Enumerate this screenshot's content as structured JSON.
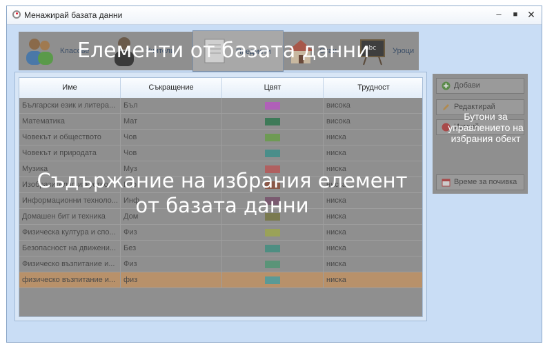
{
  "window": {
    "title": "Менажирай базата данни"
  },
  "tabs": [
    {
      "label": "Класове",
      "icon": "users-icon"
    },
    {
      "label": "Учители",
      "icon": "teacher-icon"
    },
    {
      "label": "Предмети",
      "icon": "notebook-icon"
    },
    {
      "label": "Стаи",
      "icon": "house-icon"
    },
    {
      "label": "Уроци",
      "icon": "chalkboard-icon"
    }
  ],
  "overlays": {
    "tabs": "Елементи от базата данни",
    "content_line1": "Съдържание на избрания елемент",
    "content_line2": "от базата данни",
    "buttons": "Бутони за управлението на избрания обект"
  },
  "grid": {
    "columns": [
      "Име",
      "Съкращение",
      "Цвят",
      "Трудност"
    ],
    "rows": [
      {
        "name": "Български език и литера...",
        "abbr": "Бъл",
        "color": "#b060b8",
        "difficulty": "висока"
      },
      {
        "name": "Математика",
        "abbr": "Мат",
        "color": "#3e7a58",
        "difficulty": "висока"
      },
      {
        "name": "Човекът и обществото",
        "abbr": "Чов",
        "color": "#6e9a54",
        "difficulty": "ниска"
      },
      {
        "name": "Човекът и природата",
        "abbr": "Чов",
        "color": "#4a8e8a",
        "difficulty": "ниска"
      },
      {
        "name": "Музика",
        "abbr": "Муз",
        "color": "#b06060",
        "difficulty": "ниска"
      },
      {
        "name": "Изобразително изкуство",
        "abbr": "Изо",
        "color": "#8a5848",
        "difficulty": "ниска"
      },
      {
        "name": "Информационни техноло...",
        "abbr": "Инф",
        "color": "#7a5a70",
        "difficulty": "ниска"
      },
      {
        "name": "Домашен бит и техника",
        "abbr": "Дом",
        "color": "#7a7a50",
        "difficulty": "ниска"
      },
      {
        "name": "Физическа култура и спо...",
        "abbr": "Физ",
        "color": "#9aa258",
        "difficulty": "ниска"
      },
      {
        "name": "Безопасност на движени...",
        "abbr": "Без",
        "color": "#4e8e82",
        "difficulty": "ниска"
      },
      {
        "name": "Физическо възпитание и...",
        "abbr": "Физ",
        "color": "#5a9478",
        "difficulty": "ниска"
      },
      {
        "name": "физическо възпитание и...",
        "abbr": "физ",
        "color": "#5a9a96",
        "difficulty": "ниска",
        "selected": true
      }
    ]
  },
  "buttons": {
    "add": "Добави",
    "edit": "Редактирай",
    "delete": "Изтрий",
    "break_time": "Време за почивка"
  }
}
